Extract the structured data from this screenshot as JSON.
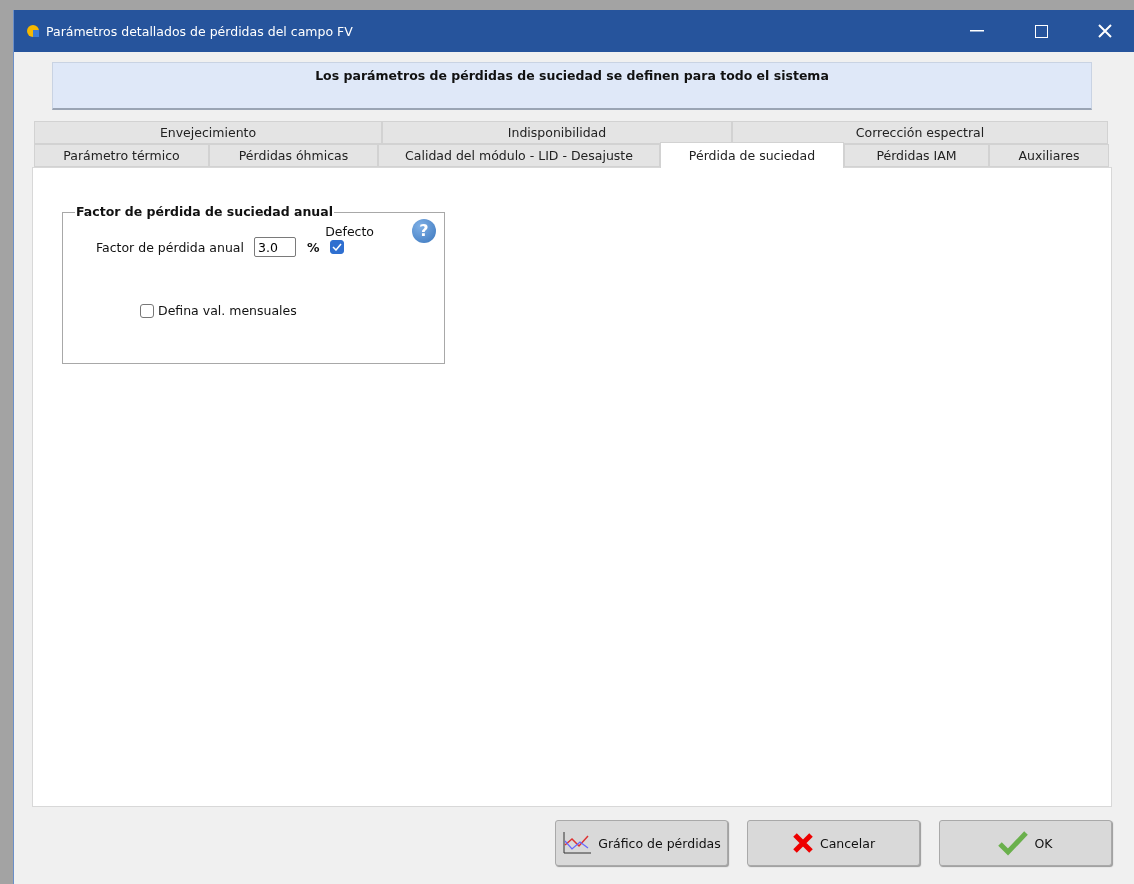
{
  "window": {
    "title": "Parámetros detallados de pérdidas del campo FV"
  },
  "banner": "Los parámetros de pérdidas de suciedad se definen para todo el sistema",
  "tab_rows": [
    {
      "tabs": [
        {
          "label": "Envejecimiento",
          "selected": false
        },
        {
          "label": "Indisponibilidad",
          "selected": false
        },
        {
          "label": "Corrección espectral",
          "selected": false
        }
      ]
    },
    {
      "tabs": [
        {
          "label": "Parámetro térmico",
          "selected": false
        },
        {
          "label": "Pérdidas óhmicas",
          "selected": false
        },
        {
          "label": "Calidad del módulo - LID - Desajuste",
          "selected": false
        },
        {
          "label": "Pérdida de suciedad",
          "selected": true
        },
        {
          "label": "Pérdidas IAM",
          "selected": false
        },
        {
          "label": "Auxiliares",
          "selected": false
        }
      ]
    }
  ],
  "group": {
    "help": "?",
    "title": "Factor de pérdida de suciedad anual",
    "field_label": "Factor de pérdida anual",
    "value": "3.0",
    "unit": "%",
    "default_label": "Defecto",
    "default_checked": true,
    "monthly_label": "Defina val. mensuales",
    "monthly_checked": false
  },
  "buttons": [
    {
      "kind": "chart",
      "label": "Gráfico de pérdidas"
    },
    {
      "kind": "cancel",
      "label": "Cancelar"
    },
    {
      "kind": "ok",
      "label": "OK"
    }
  ]
}
